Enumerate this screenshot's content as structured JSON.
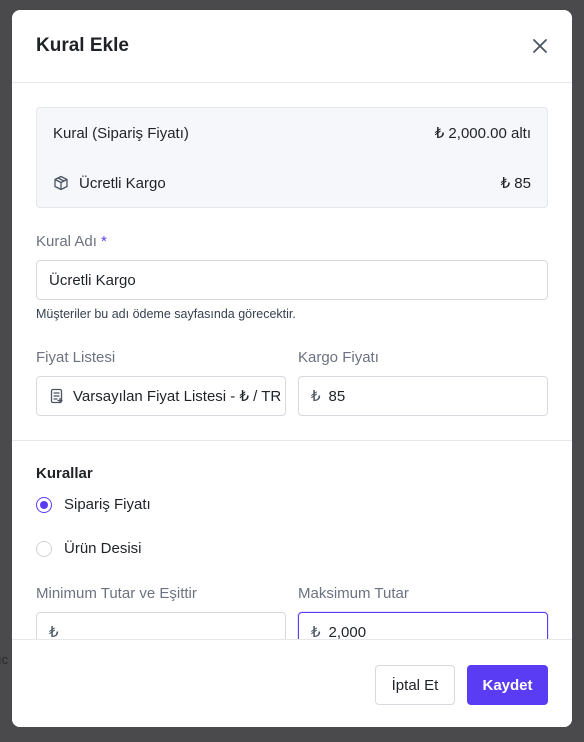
{
  "backdrop": {
    "fragment": "ıc"
  },
  "modal": {
    "title": "Kural Ekle",
    "close_icon": "close-icon"
  },
  "summary": {
    "rule_label": "Kural (Sipariş Fiyatı)",
    "rule_value": "₺ 2,000.00 altı",
    "shipping_icon": "package-icon",
    "shipping_label": "Ücretli Kargo",
    "shipping_value": "₺ 85"
  },
  "rule_name": {
    "label": "Kural Adı",
    "required_mark": "*",
    "value": "Ücretli Kargo",
    "hint": "Müşteriler bu adı ödeme sayfasında görecektir."
  },
  "price_list": {
    "label": "Fiyat Listesi",
    "icon": "price-list-icon",
    "value": "Varsayılan Fiyat Listesi - ₺ / TR"
  },
  "shipping_price": {
    "label": "Kargo Fiyatı",
    "currency": "₺",
    "value": "85"
  },
  "rules": {
    "title": "Kurallar",
    "options": [
      {
        "label": "Sipariş Fiyatı",
        "checked": true
      },
      {
        "label": "Ürün Desisi",
        "checked": false
      }
    ]
  },
  "min_amount": {
    "label": "Minimum Tutar ve Eşittir",
    "currency": "₺",
    "value": ""
  },
  "max_amount": {
    "label": "Maksimum Tutar",
    "currency": "₺",
    "value": "2,000"
  },
  "footer": {
    "cancel_label": "İptal Et",
    "save_label": "Kaydet"
  },
  "colors": {
    "accent": "#5b3cf5",
    "backdrop": "#4a4a4c",
    "summary_bg": "#f5f7fa"
  }
}
